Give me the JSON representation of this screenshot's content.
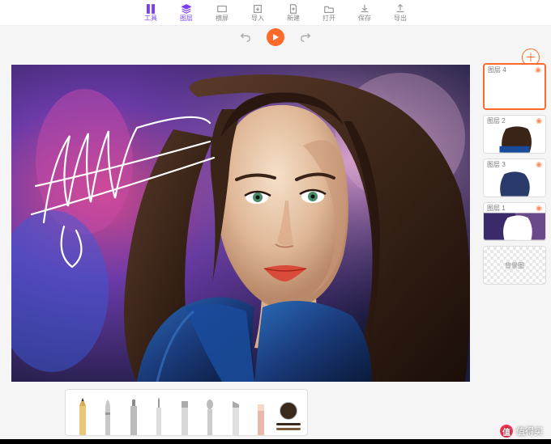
{
  "toolbar": {
    "tool": "工具",
    "layers": "图层",
    "transform": "横屏",
    "import": "导入",
    "new": "新建",
    "open": "打开",
    "save": "保存",
    "export": "导出"
  },
  "layers_panel": {
    "items": [
      {
        "label": "图层 4",
        "selected": true,
        "thumb": "blank"
      },
      {
        "label": "图层 2",
        "selected": false,
        "thumb": "portrait"
      },
      {
        "label": "图层 3",
        "selected": false,
        "thumb": "hair"
      },
      {
        "label": "图层 1",
        "selected": false,
        "thumb": "silhouette"
      },
      {
        "label": "背景图",
        "selected": false,
        "thumb": "bg"
      }
    ]
  },
  "brushes": {
    "current_color": "#3a2a1e",
    "secondary_color": "#7a5a3a",
    "items": [
      "pencil",
      "pen",
      "marker",
      "fine",
      "flat",
      "airbrush",
      "chisel",
      "eraser"
    ]
  },
  "watermark": {
    "badge": "值",
    "text": "值得买"
  }
}
